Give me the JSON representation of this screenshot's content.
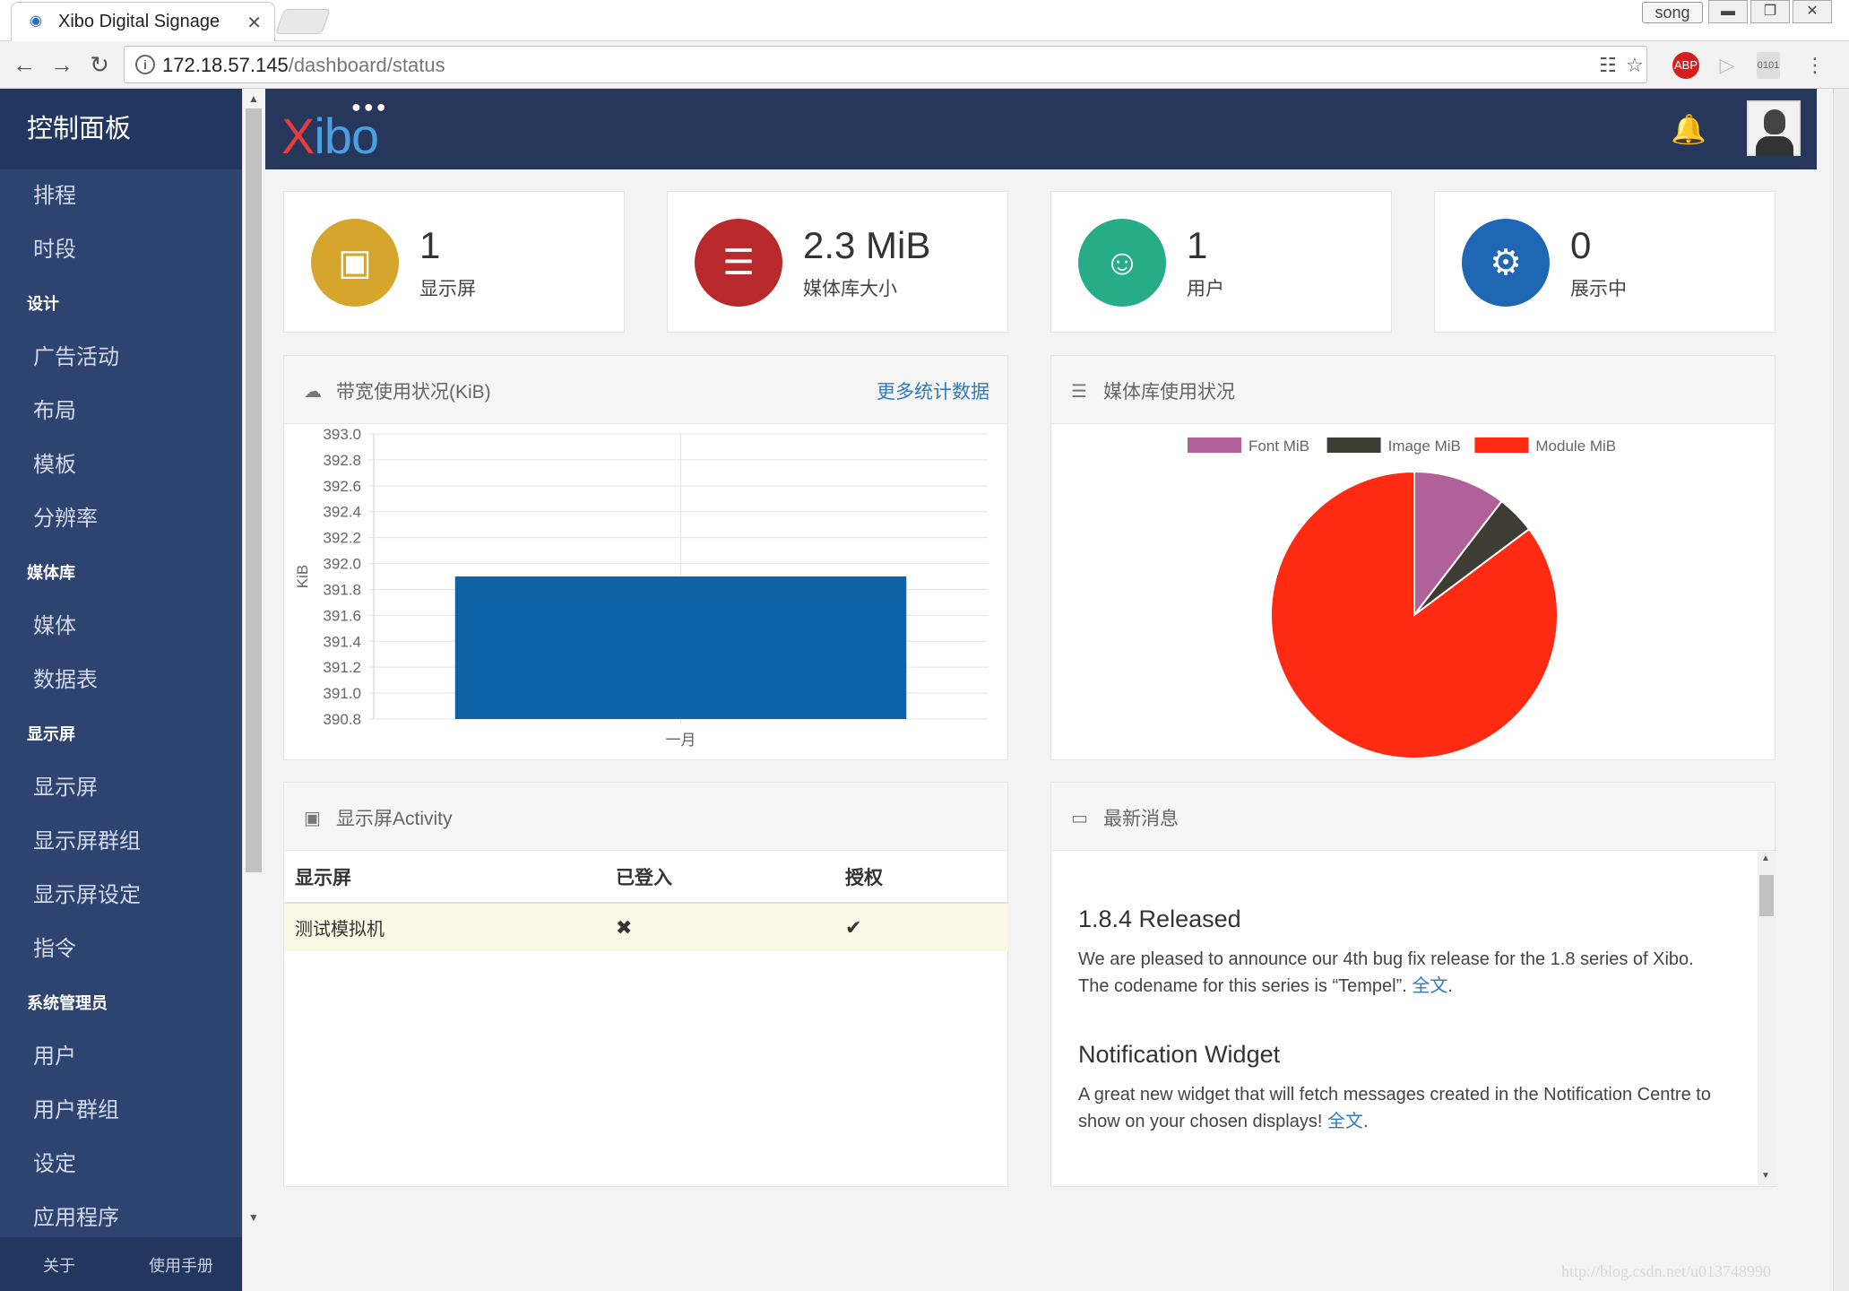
{
  "browser": {
    "tab_title": "Xibo Digital Signage",
    "tab_close": "✕",
    "user_chip": "song",
    "url_host": "172.18.57.145",
    "url_path": "/dashboard/status"
  },
  "sidebar": {
    "brand": "控制面板",
    "groups": [
      {
        "items": [
          "排程",
          "时段"
        ]
      },
      {
        "section": "设计",
        "items": [
          "广告活动",
          "布局",
          "模板",
          "分辨率"
        ]
      },
      {
        "section": "媒体库",
        "items": [
          "媒体",
          "数据表"
        ]
      },
      {
        "section": "显示屏",
        "items": [
          "显示屏",
          "显示屏群组",
          "显示屏设定",
          "指令"
        ]
      },
      {
        "section": "系统管理员",
        "items": [
          "用户",
          "用户群组",
          "设定",
          "应用程序"
        ]
      }
    ],
    "footer": {
      "about": "关于",
      "manual": "使用手册"
    }
  },
  "header": {
    "logo": "Xibo"
  },
  "stats": [
    {
      "value": "1",
      "label": "显示屏",
      "color": "#d5a52c",
      "icon": "monitor-icon"
    },
    {
      "value": "2.3 MiB",
      "label": "媒体库大小",
      "color": "#b8292b",
      "icon": "server-icon"
    },
    {
      "value": "1",
      "label": "用户",
      "color": "#26ad87",
      "icon": "users-icon"
    },
    {
      "value": "0",
      "label": "展示中",
      "color": "#1f66b4",
      "icon": "gears-icon"
    }
  ],
  "bandwidth_panel": {
    "title": "带宽使用状况(KiB)",
    "link": "更多统计数据"
  },
  "library_panel": {
    "title": "媒体库使用状况"
  },
  "activity_panel": {
    "title": "显示屏Activity",
    "columns": [
      "显示屏",
      "已登入",
      "授权"
    ],
    "rows": [
      {
        "display": "测试模拟机",
        "logged_in": "✖",
        "authorised": "✔"
      }
    ]
  },
  "news_panel": {
    "title": "最新消息",
    "items": [
      {
        "title": "1.8.4 Released",
        "body": "We are pleased to announce our 4th bug fix release for the 1.8 series of Xibo. The codename for this series is “Tempel”. ",
        "link": "全文",
        "tail": "."
      },
      {
        "title": "Notification Widget",
        "body": "A great new widget that will fetch messages created in the Notification Centre to show on your chosen displays! ",
        "link": "全文",
        "tail": "."
      }
    ]
  },
  "watermark": "http://blog.csdn.net/u013748990",
  "chart_data": [
    {
      "type": "bar",
      "title": "",
      "ylabel": "KiB",
      "categories": [
        "一月"
      ],
      "values": [
        391.9
      ],
      "ylim": [
        390.8,
        393.0
      ],
      "yticks": [
        "393.0",
        "392.8",
        "392.6",
        "392.4",
        "392.2",
        "392.0",
        "391.8",
        "391.6",
        "391.4",
        "391.2",
        "391.0",
        "390.8"
      ],
      "color": "#0e63a6",
      "grid": true
    },
    {
      "type": "pie",
      "legend_position": "top",
      "labels": [
        "Font MiB",
        "Image MiB",
        "Module MiB"
      ],
      "values": [
        0.24,
        0.1,
        1.96
      ],
      "colors": [
        "#b06298",
        "#3e3d33",
        "#ff2a12"
      ]
    }
  ]
}
